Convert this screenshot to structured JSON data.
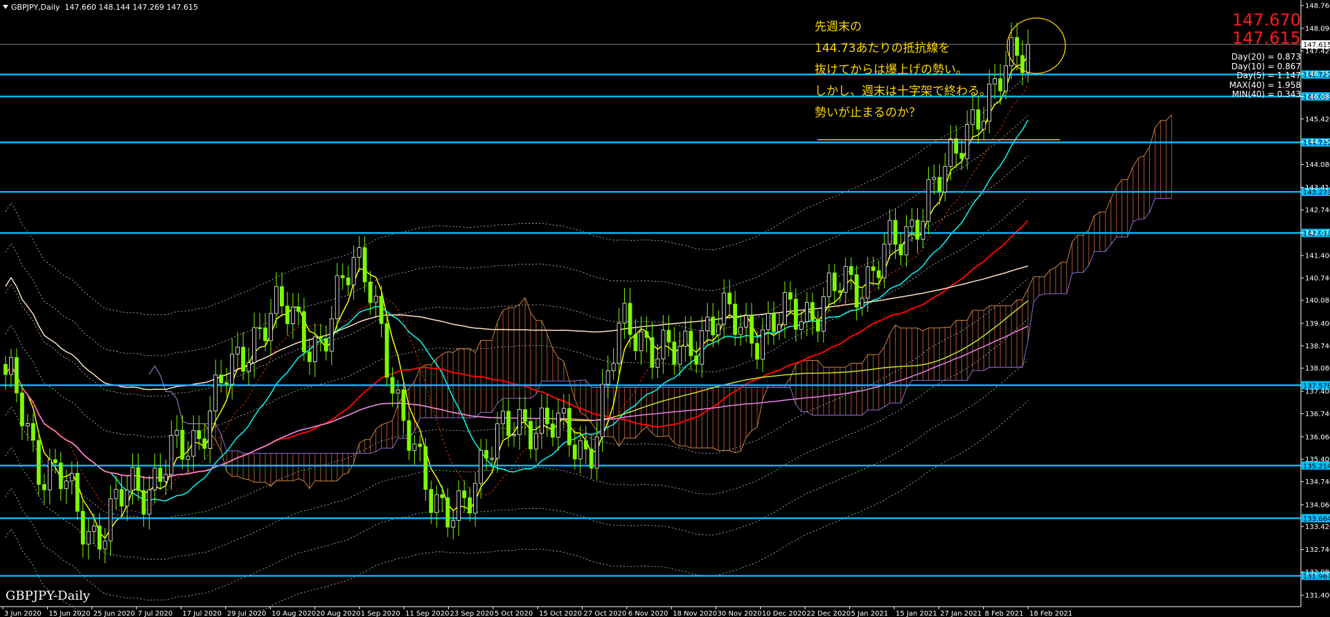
{
  "header": {
    "symbol_tf": "GBPJPY,Daily",
    "ohlc": "147.660 148.144 147.269 147.615"
  },
  "prices": {
    "ask": "147.670",
    "bid": "147.615"
  },
  "stats": [
    "Day(20) = 0.873",
    "Day(10) = 0.867",
    "Day(5) = 1.147",
    "MAX(40) = 1.958",
    "MIN(40) = 0.343"
  ],
  "annotation": [
    "先週末の",
    "144.73あたりの抵抗線を",
    "抜けてからは爆上げの勢い。",
    "しかし、週末は十字架で終わる。",
    "勢いが止まるのか？"
  ],
  "watermark": "GBPJPY-Daily",
  "colors": {
    "level": "#00bfff",
    "up_candle": "#7cfc00",
    "text_anno": "#ffd700",
    "price_red": "#ff1a1a"
  },
  "chart_data": {
    "type": "candlestick",
    "symbol": "GBPJPY",
    "timeframe": "Daily",
    "ylim": [
      131.06,
      148.76
    ],
    "y_ticks": [
      "148.760",
      "148.090",
      "147.420",
      "146.750",
      "146.080",
      "145.420",
      "144.750",
      "144.080",
      "143.410",
      "142.740",
      "142.070",
      "141.400",
      "140.740",
      "140.080",
      "139.400",
      "138.740",
      "138.080",
      "137.400",
      "136.740",
      "136.060",
      "135.400",
      "134.740",
      "134.060",
      "133.420",
      "132.740",
      "132.080",
      "131.400"
    ],
    "x_ticks": [
      "3 Jun 2020",
      "15 Jun 2020",
      "25 Jun 2020",
      "7 Jul 2020",
      "17 Jul 2020",
      "29 Jul 2020",
      "10 Aug 2020",
      "20 Aug 2020",
      "1 Sep 2020",
      "11 Sep 2020",
      "23 Sep 2020",
      "5 Oct 2020",
      "15 Oct 2020",
      "27 Oct 2020",
      "6 Nov 2020",
      "18 Nov 2020",
      "30 Nov 2020",
      "10 Dec 2020",
      "22 Dec 2020",
      "5 Jan 2021",
      "15 Jan 2021",
      "27 Jan 2021",
      "8 Feb 2021",
      "18 Feb 2021"
    ],
    "levels": [
      {
        "price": 146.729,
        "label": "146.729"
      },
      {
        "price": 146.083,
        "label": "146.083"
      },
      {
        "price": 144.73,
        "label": "144.730"
      },
      {
        "price": 143.273,
        "label": "143.273"
      },
      {
        "price": 142.063,
        "label": "142.063"
      },
      {
        "price": 137.578,
        "label": "137.578"
      },
      {
        "price": 135.214,
        "label": "135.214"
      },
      {
        "price": 133.664,
        "label": "133.664"
      },
      {
        "price": 131.967,
        "label": "131.967"
      }
    ],
    "current_price": {
      "price": 147.615,
      "label": "147.615"
    },
    "key_closes": [
      137.6,
      135.0,
      133.3,
      134.6,
      135.6,
      137.8,
      139.8,
      138.9,
      141.3,
      136.2,
      133.5,
      136.0,
      136.6,
      135.7,
      139.3,
      138.4,
      139.5,
      139.2,
      139.8,
      140.5,
      141.6,
      143.6,
      145.9,
      147.6
    ]
  }
}
